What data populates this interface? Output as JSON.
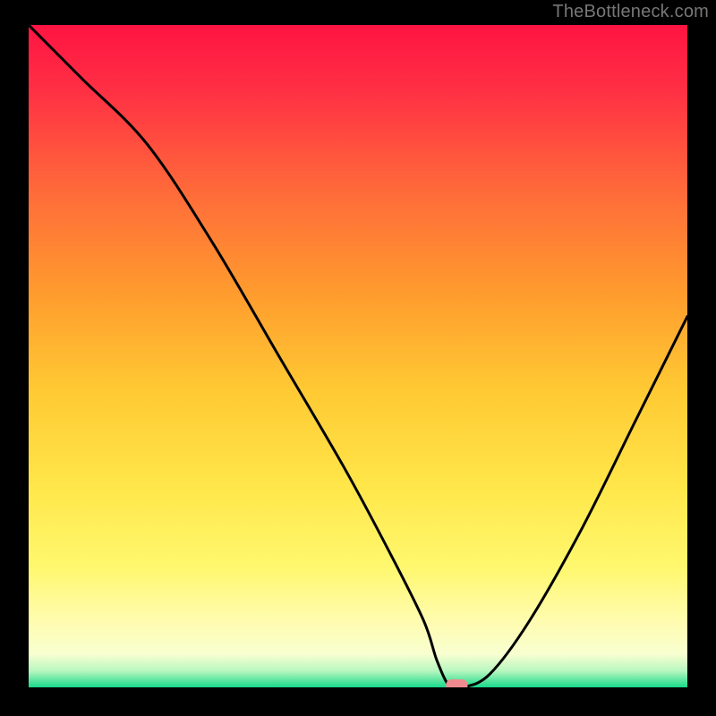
{
  "watermark": "TheBottleneck.com",
  "chart_data": {
    "type": "line",
    "title": "",
    "xlabel": "",
    "ylabel": "",
    "xlim": [
      0,
      100
    ],
    "ylim": [
      0,
      100
    ],
    "grid": false,
    "series": [
      {
        "name": "curve",
        "x": [
          0,
          8,
          18,
          28,
          38,
          48,
          55,
          60,
          62,
          64,
          66,
          70,
          76,
          84,
          92,
          100
        ],
        "y": [
          100,
          92,
          82,
          67,
          50,
          33,
          20,
          10,
          4,
          0,
          0,
          2,
          10,
          24,
          40,
          56
        ]
      }
    ],
    "marker": {
      "x": 65,
      "y": 0
    },
    "gradient_stops": [
      {
        "offset": 0.0,
        "color": "#ff1442"
      },
      {
        "offset": 0.1,
        "color": "#ff3044"
      },
      {
        "offset": 0.25,
        "color": "#ff6a3a"
      },
      {
        "offset": 0.4,
        "color": "#ff9a2e"
      },
      {
        "offset": 0.55,
        "color": "#ffc933"
      },
      {
        "offset": 0.7,
        "color": "#ffe74a"
      },
      {
        "offset": 0.82,
        "color": "#fff86f"
      },
      {
        "offset": 0.9,
        "color": "#fffcb0"
      },
      {
        "offset": 0.95,
        "color": "#f8ffd0"
      },
      {
        "offset": 0.975,
        "color": "#b8f7c0"
      },
      {
        "offset": 1.0,
        "color": "#18d989"
      }
    ]
  }
}
